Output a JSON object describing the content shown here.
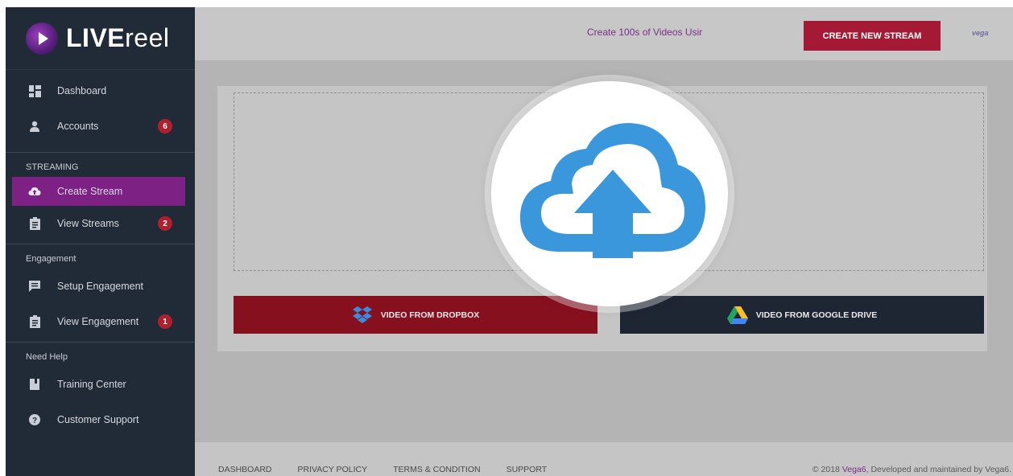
{
  "app": {
    "logo_bold": "LIVE",
    "logo_light": "reel"
  },
  "sidebar": {
    "items": [
      {
        "label": "Dashboard",
        "icon": "dashboard-icon"
      },
      {
        "label": "Accounts",
        "icon": "user-icon",
        "badge": "6"
      }
    ],
    "sections": [
      {
        "title": "STREAMING",
        "items": [
          {
            "label": "Create Stream",
            "icon": "cloud-upload-icon",
            "active": true
          },
          {
            "label": "View Streams",
            "icon": "clipboard-icon",
            "badge": "2"
          }
        ]
      },
      {
        "title": "Engagement",
        "items": [
          {
            "label": "Setup Engagement",
            "icon": "message-icon"
          },
          {
            "label": "View Engagement",
            "icon": "clipboard-icon",
            "badge": "1"
          }
        ]
      },
      {
        "title": "Need Help",
        "items": [
          {
            "label": "Training Center",
            "icon": "book-icon"
          },
          {
            "label": "Customer Support",
            "icon": "help-icon"
          }
        ]
      }
    ]
  },
  "header": {
    "promo": "Create 100s of Videos Usir",
    "create_button": "CREATE NEW STREAM",
    "brand": "vega"
  },
  "upload": {
    "dropbox_label": "VIDEO FROM DROPBOX",
    "gdrive_label": "VIDEO FROM GOOGLE DRIVE"
  },
  "footer": {
    "links": [
      "DASHBOARD",
      "PRIVACY POLICY",
      "TERMS & CONDITION",
      "SUPPORT"
    ],
    "copyright_prefix": "© 2018 ",
    "copyright_link": "Vega6",
    "copyright_suffix": ", Developed and maintained by Vega6."
  },
  "colors": {
    "sidebar_bg": "#212a37",
    "active_item": "#7d2185",
    "badge": "#b0202c",
    "primary_red": "#a41a34",
    "cloud_blue": "#3a97dc"
  }
}
